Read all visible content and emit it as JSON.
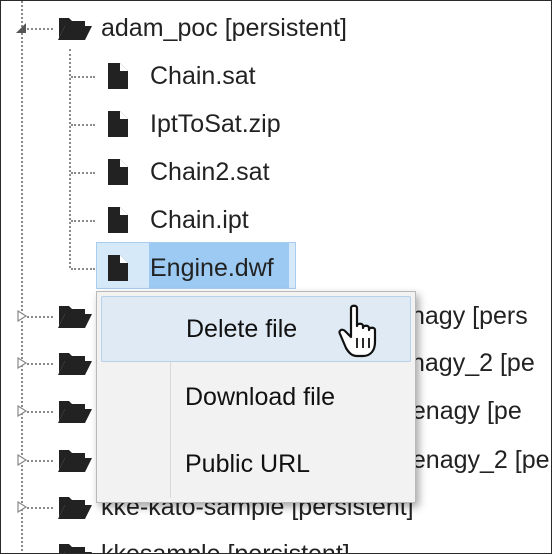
{
  "tree": {
    "root_folder": {
      "label": "adam_poc [persistent]",
      "icon": "folder-open-icon",
      "expanded": true
    },
    "files": [
      {
        "label": "Chain.sat",
        "icon": "file-icon"
      },
      {
        "label": "IptToSat.zip",
        "icon": "file-icon"
      },
      {
        "label": "Chain2.sat",
        "icon": "file-icon"
      },
      {
        "label": "Chain.ipt",
        "icon": "file-icon"
      },
      {
        "label": "Engine.dwf",
        "icon": "file-icon",
        "selected": true
      }
    ],
    "folders": [
      {
        "label": "nagy [pers"
      },
      {
        "label": "nagy_2 [pe"
      },
      {
        "label": "henagy [pe"
      },
      {
        "label": "henagy_2 [pe"
      },
      {
        "label": "kke-kato-sample [persistent]"
      },
      {
        "label": "kkesample [persistent]"
      }
    ]
  },
  "context_menu": {
    "items": [
      {
        "label": "Delete file",
        "active": true
      },
      {
        "label": "Download file"
      },
      {
        "label": "Public URL"
      }
    ]
  },
  "cursor": {
    "type": "hand-pointer-icon"
  },
  "colors": {
    "selection_bg": "#d6e9f8",
    "selection_label_bg": "#9ccaf2",
    "menu_bg": "#f2f2f2",
    "menu_active_bg": "#dfeaf5"
  }
}
